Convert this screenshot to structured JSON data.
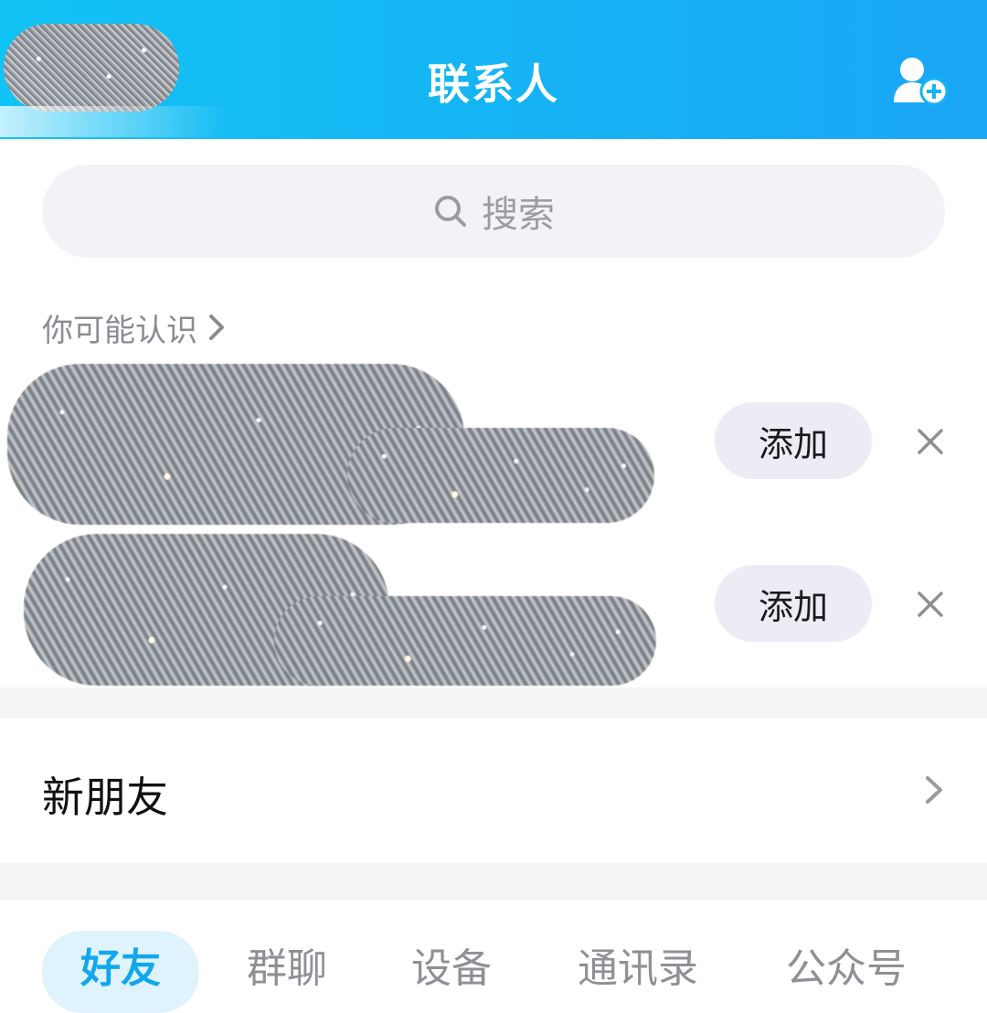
{
  "header": {
    "title": "联系人",
    "add_contact_icon": "person-add-icon"
  },
  "search": {
    "placeholder": "搜索",
    "icon": "search-icon"
  },
  "people_you_may_know": {
    "heading": "你可能认识",
    "items": [
      {
        "add_label": "添加",
        "dismiss_icon": "close-icon"
      },
      {
        "add_label": "添加",
        "dismiss_icon": "close-icon"
      }
    ]
  },
  "new_friends": {
    "label": "新朋友",
    "chevron_icon": "chevron-right-icon"
  },
  "tabs": [
    {
      "label": "好友",
      "active": true
    },
    {
      "label": "群聊",
      "active": false
    },
    {
      "label": "设备",
      "active": false
    },
    {
      "label": "通讯录",
      "active": false
    },
    {
      "label": "公众号",
      "active": false
    }
  ],
  "colors": {
    "header_gradient_start": "#12c3f5",
    "header_gradient_end": "#1ba6f6",
    "active_tab_text": "#11a7ef",
    "active_tab_bg": "#dff3fc",
    "add_button_bg": "#ececf5"
  }
}
